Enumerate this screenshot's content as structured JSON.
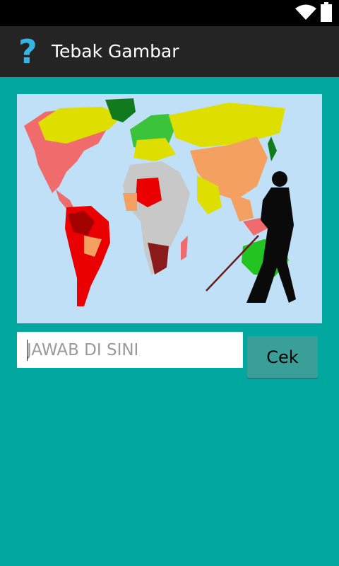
{
  "app": {
    "title": "Tebak Gambar",
    "icon": "question-mark-icon",
    "icon_glyph": "?"
  },
  "status_bar": {
    "icons": [
      "wifi-icon",
      "battery-icon"
    ]
  },
  "hero_image": {
    "description_icon": "world-map-with-blind-person-image"
  },
  "answer": {
    "placeholder": "JAWAB DI SINI",
    "value": ""
  },
  "actions": {
    "check_label": "Cek"
  },
  "colors": {
    "background": "#00a8a0",
    "action_bar": "#242424",
    "accent": "#33b5e5",
    "button": "#3a9f98"
  }
}
